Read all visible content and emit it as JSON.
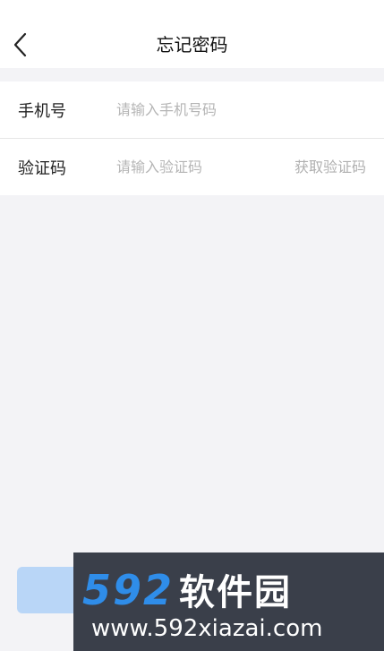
{
  "header": {
    "title": "忘记密码"
  },
  "form": {
    "phone": {
      "label": "手机号",
      "placeholder": "请输入手机号码",
      "value": ""
    },
    "code": {
      "label": "验证码",
      "placeholder": "请输入验证码",
      "value": "",
      "get_code_label": "获取验证码"
    }
  },
  "watermark": {
    "logo_digits": "592",
    "logo_cn": "软件园",
    "url": "www.592xiazai.com"
  },
  "colors": {
    "background": "#f3f3f6",
    "button": "#b9d6f7",
    "watermark_bg": "#3a3f4a",
    "watermark_blue": "#2f8de9"
  },
  "icons": {
    "back": "chevron-left-icon"
  }
}
